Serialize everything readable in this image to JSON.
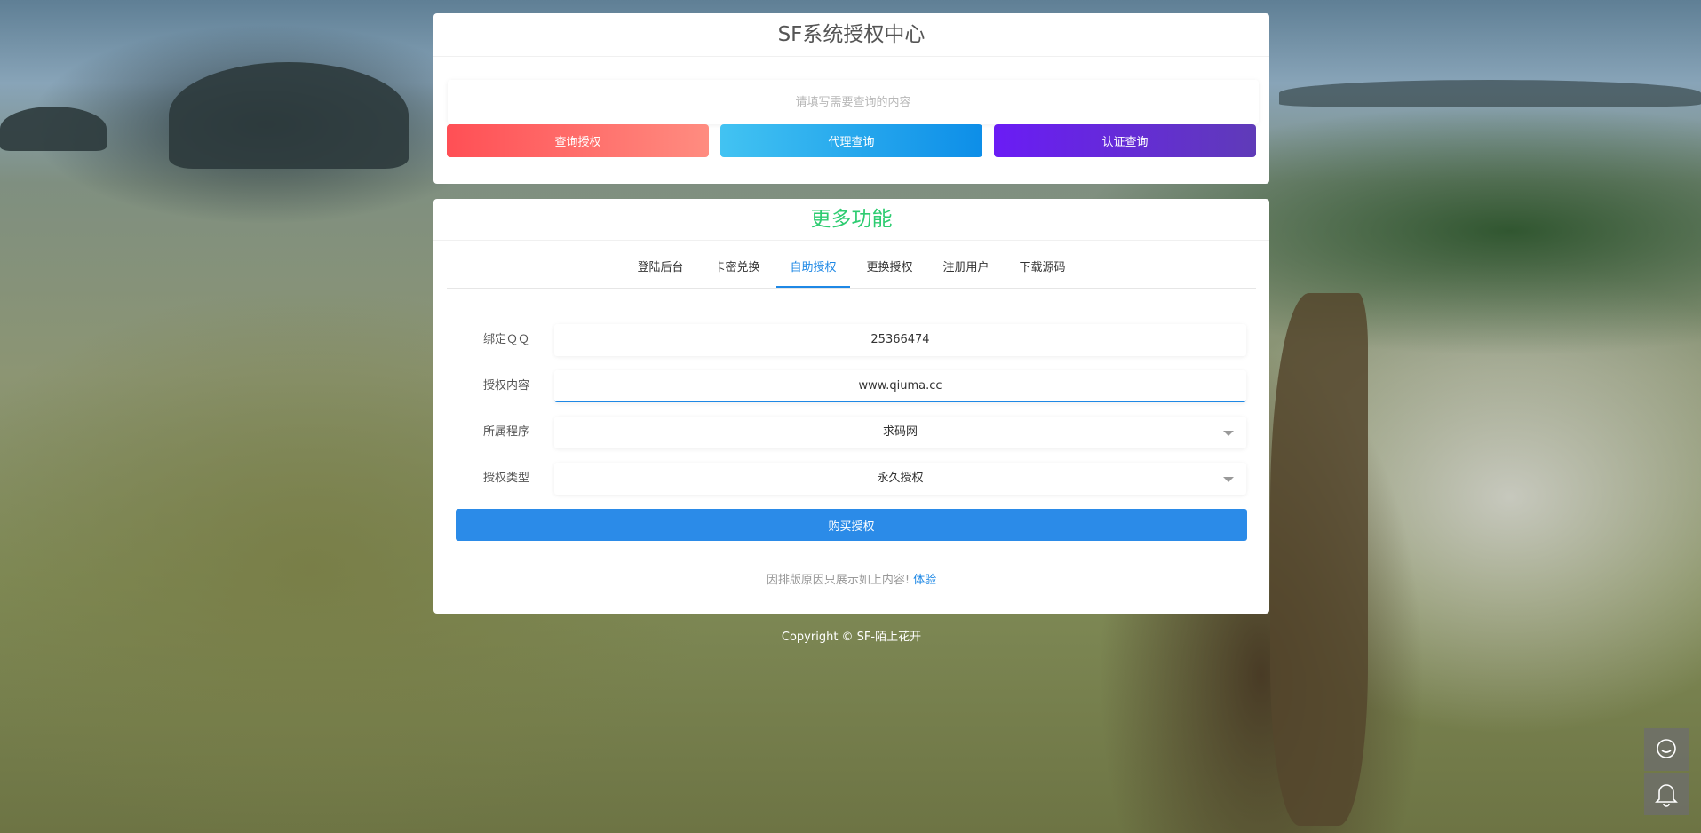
{
  "query_card": {
    "title": "SF系统授权中心",
    "search_placeholder": "请填写需要查询的内容",
    "buttons": {
      "query_auth": "查询授权",
      "agent_query": "代理查询",
      "verify_query": "认证查询"
    }
  },
  "more_card": {
    "title": "更多功能",
    "tabs": [
      "登陆后台",
      "卡密兑换",
      "自助授权",
      "更换授权",
      "注册用户",
      "下载源码"
    ],
    "active_tab": "自助授权",
    "form": {
      "qq_label": "绑定ＱＱ",
      "qq_value": "25366474",
      "content_label": "授权内容",
      "content_value": "www.qiuma.cc",
      "program_label": "所属程序",
      "program_value": "求码网",
      "type_label": "授权类型",
      "type_value": "永久授权",
      "buy_button": "购买授权"
    },
    "note": {
      "text": "因排版原因只展示如上内容!",
      "link": "体验"
    }
  },
  "footer": {
    "copyright": "Copyright © SF-陌上花开"
  },
  "side_buttons": {
    "chat_icon": "chat-bubble-icon",
    "bell_icon": "bell-icon"
  },
  "colors": {
    "active_tab": "#1e88e5",
    "more_title": "#2ecc71",
    "buy_button": "#2b8be8"
  }
}
